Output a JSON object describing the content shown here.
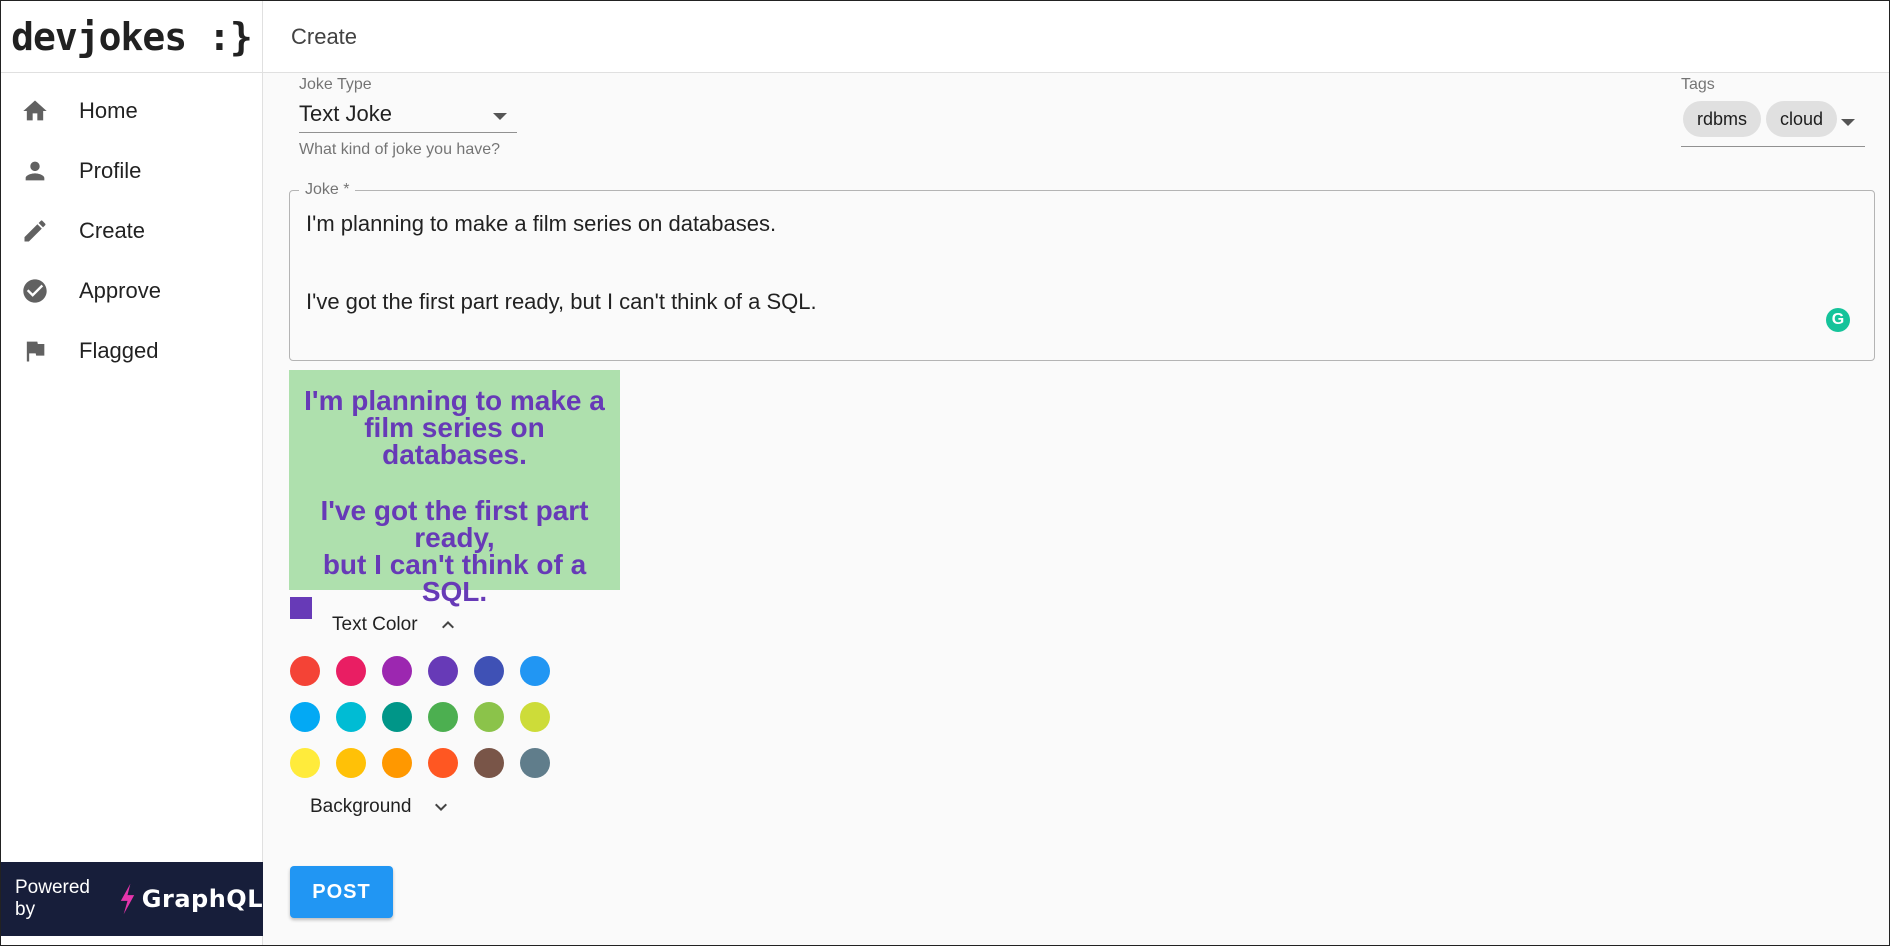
{
  "sidebar": {
    "logo": "devjokes :}",
    "items": [
      {
        "label": "Home",
        "icon": "home-icon"
      },
      {
        "label": "Profile",
        "icon": "person-icon"
      },
      {
        "label": "Create",
        "icon": "pencil-icon"
      },
      {
        "label": "Approve",
        "icon": "check-circle-icon"
      },
      {
        "label": "Flagged",
        "icon": "flag-icon"
      }
    ],
    "powered_by": "Powered by",
    "powered_brand": "GraphQL"
  },
  "header": {
    "title": "Create"
  },
  "form": {
    "joke_type": {
      "label": "Joke Type",
      "value": "Text Joke",
      "helper": "What kind of joke you have?"
    },
    "tags": {
      "label": "Tags",
      "values": [
        "rdbms",
        "cloud"
      ]
    },
    "joke": {
      "label": "Joke *",
      "line1": "I'm planning to make a film series on databases.",
      "line2": "I've got the first part ready, but I can't think of a SQL."
    },
    "preview": {
      "line1a": "I'm planning to make a",
      "line1b": "film series on databases.",
      "line2a": "I've got the first part ready,",
      "line2b": "but I can't think of a SQL.",
      "text_color": "#673ab7",
      "background_color": "#aee0ad"
    },
    "text_color_toggle": "Text Color",
    "background_toggle": "Background",
    "palette": [
      "#f44336",
      "#e91e63",
      "#9c27b0",
      "#673ab7",
      "#3f51b5",
      "#2196f3",
      "#03a9f4",
      "#00bcd4",
      "#009688",
      "#4caf50",
      "#8bc34a",
      "#cddc39",
      "#ffeb3b",
      "#ffc107",
      "#ff9800",
      "#ff5722",
      "#795548",
      "#607d8b"
    ],
    "submit": "POST"
  },
  "colors": {
    "accent": "#2196f3",
    "powered_bg": "#171e3a",
    "graphql_pink": "#e535ab"
  }
}
